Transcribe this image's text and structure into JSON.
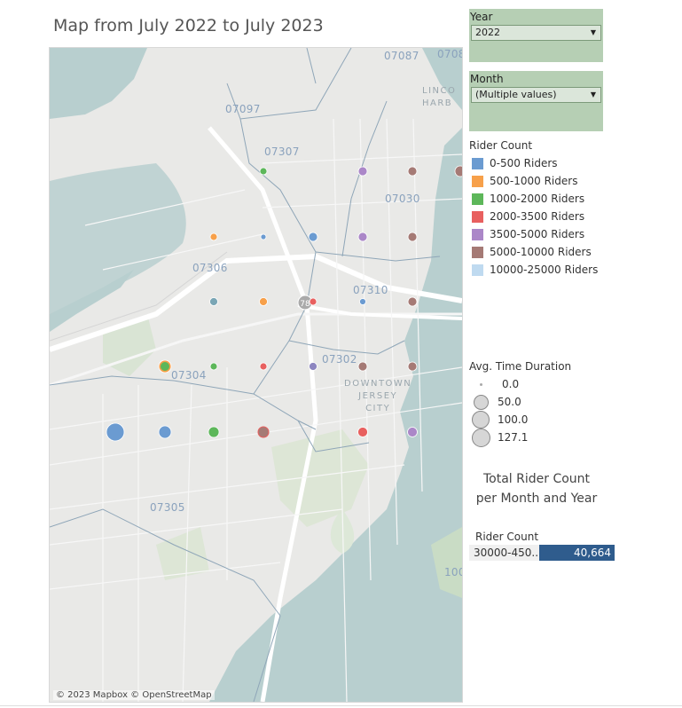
{
  "title": "Map from July 2022 to July 2023",
  "filters": {
    "year": {
      "label": "Year",
      "value": "2022"
    },
    "month": {
      "label": "Month",
      "value": "(Multiple values)"
    }
  },
  "legend": {
    "title": "Rider Count",
    "items": [
      {
        "label": "0-500 Riders",
        "color": "#6b9bd1"
      },
      {
        "label": "500-1000 Riders",
        "color": "#f7a04a"
      },
      {
        "label": "1000-2000 Riders",
        "color": "#5db75a"
      },
      {
        "label": "2000-3500 Riders",
        "color": "#e8605f"
      },
      {
        "label": "3500-5000 Riders",
        "color": "#ab87c8"
      },
      {
        "label": "5000-10000 Riders",
        "color": "#a57a75"
      },
      {
        "label": "10000-25000 Riders",
        "color": "#bfdaf0"
      }
    ]
  },
  "size_legend": {
    "title": "Avg. Time Duration",
    "items": [
      {
        "label": "0.0",
        "value": 0
      },
      {
        "label": "50.0",
        "value": 50
      },
      {
        "label": "100.0",
        "value": 100
      },
      {
        "label": "127.1",
        "value": 127.1
      }
    ]
  },
  "map": {
    "zip_labels": [
      "07087",
      "0708",
      "07097",
      "07307",
      "07030",
      "07306",
      "07310",
      "07304",
      "07302",
      "07305",
      "100"
    ],
    "place_labels": {
      "downtown": [
        "DOWNTOWN",
        "JERSEY",
        "CITY"
      ],
      "lincoln": [
        "LINCO",
        "HARB"
      ]
    },
    "interchange_label": "78",
    "attribution": "© 2023 Mapbox  © OpenStreetMap"
  },
  "total_panel": {
    "title_line1": "Total Rider Count",
    "title_line2": "per Month and Year",
    "header": "Rider Count",
    "category": "30000-450..",
    "value": "40,664"
  }
}
